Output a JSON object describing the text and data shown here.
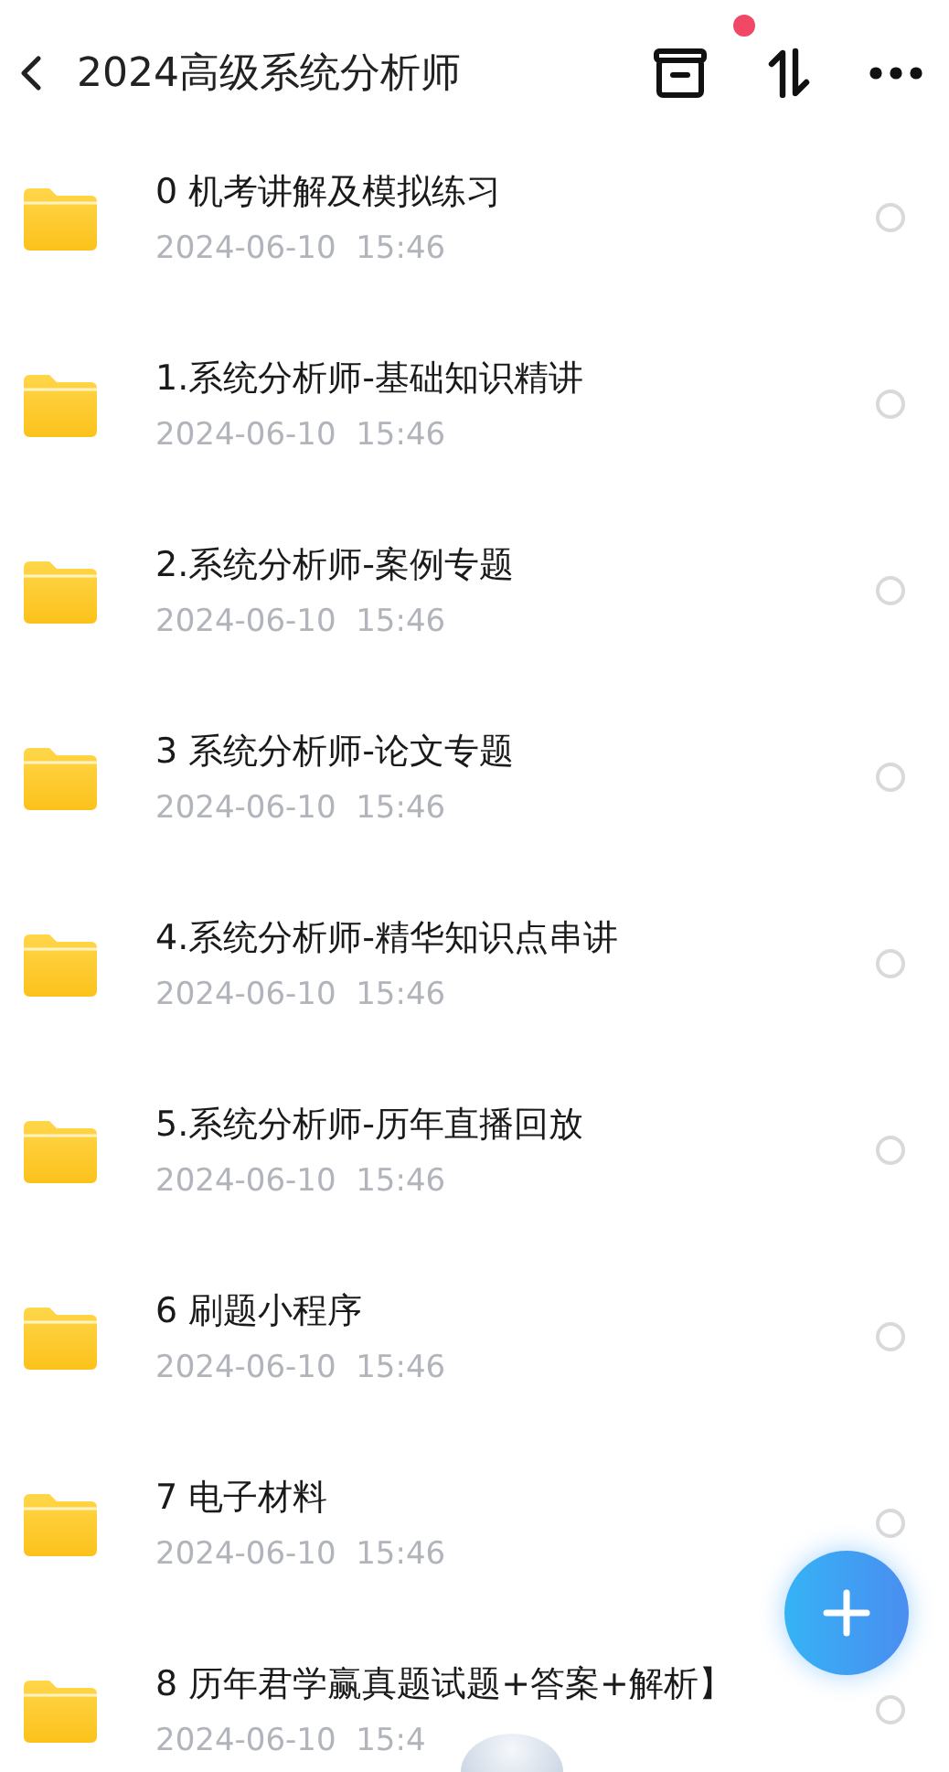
{
  "header": {
    "title": "2024高级系统分析师",
    "notification_dot": true
  },
  "files": [
    {
      "name": "0 机考讲解及模拟练习",
      "date": "2024-06-10  15:46",
      "selected": false
    },
    {
      "name": "1.系统分析师-基础知识精讲",
      "date": "2024-06-10  15:46",
      "selected": false
    },
    {
      "name": "2.系统分析师-案例专题",
      "date": "2024-06-10  15:46",
      "selected": false
    },
    {
      "name": "3 系统分析师-论文专题",
      "date": "2024-06-10  15:46",
      "selected": false
    },
    {
      "name": "4.系统分析师-精华知识点串讲",
      "date": "2024-06-10  15:46",
      "selected": false
    },
    {
      "name": "5.系统分析师-历年直播回放",
      "date": "2024-06-10  15:46",
      "selected": false
    },
    {
      "name": "6 刷题小程序",
      "date": "2024-06-10  15:46",
      "selected": false
    },
    {
      "name": "7 电子材料",
      "date": "2024-06-10  15:46",
      "selected": false
    },
    {
      "name": "8 历年君学赢真题试题+答案+解析】",
      "date": "2024-06-10  15:4",
      "selected": false
    }
  ]
}
